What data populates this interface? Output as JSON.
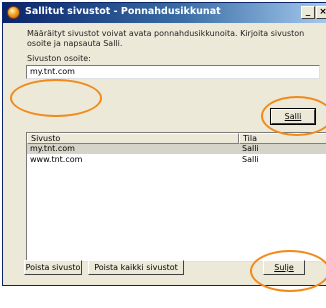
{
  "window": {
    "title": "Sallitut sivustot - Ponnahdusikkunat",
    "minimize_glyph": "_",
    "close_glyph": "×"
  },
  "description": "Määräityt sivustot voivat avata ponnahdusikkunoita. Kirjoita sivuston osoite ja napsauta Salli.",
  "address": {
    "label": "Sivuston osoite:",
    "value": "my.tnt.com"
  },
  "allow_button": "Salli",
  "table": {
    "columns": [
      "Sivusto",
      "Tila"
    ],
    "rows": [
      {
        "site": "my.tnt.com",
        "status": "Salli"
      },
      {
        "site": "www.tnt.com",
        "status": "Salli"
      }
    ]
  },
  "footer": {
    "remove_site": "Poista sivusto",
    "remove_all": "Poista kaikki sivustot",
    "close": "Sulje"
  },
  "colors": {
    "annotation": "#f28a1a",
    "title_bar": "#0a246a"
  }
}
